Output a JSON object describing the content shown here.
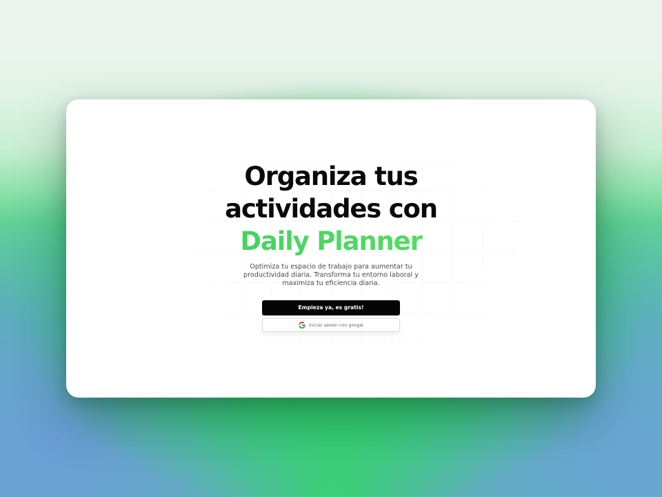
{
  "hero": {
    "title_lines": [
      "Organiza tus",
      "actividades con"
    ],
    "title_highlight": "Daily Planner",
    "subtitle_lines": [
      "Optimiza tu espacio de trabajo para aumentar tu",
      "productividad diaria. Transforma tu entorno laboral y",
      "maximiza tu eficiencia diaria."
    ]
  },
  "actions": {
    "primary_label": "Empieza ya, es gratis!",
    "google_label": "Iniciar sesion con google",
    "google_icon": "google-icon"
  },
  "colors": {
    "highlight": "#3fd05f",
    "primary_button": "#050505",
    "background_green": "#2fd56a",
    "background_blue": "#6aa6d4"
  }
}
